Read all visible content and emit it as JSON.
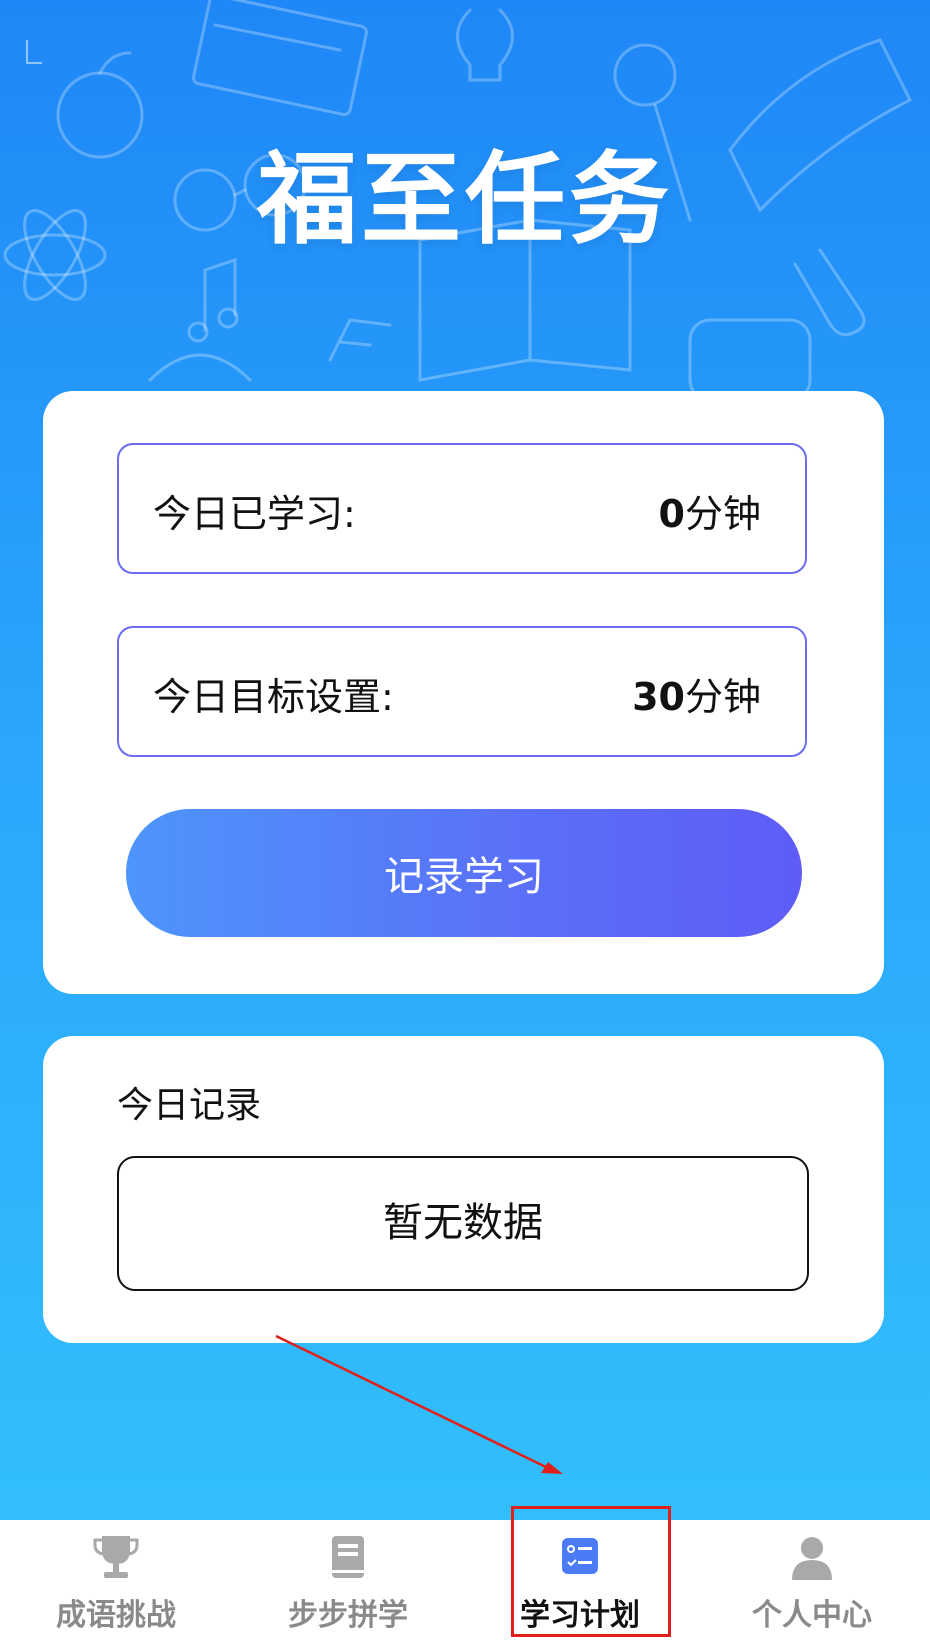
{
  "header": {
    "title": "福至任务"
  },
  "today_card": {
    "studied_label": "今日已学习:",
    "studied_value": "0",
    "studied_unit": "分钟",
    "goal_label": "今日目标设置:",
    "goal_value": "30",
    "goal_unit": "分钟",
    "record_button": "记录学习"
  },
  "record_card": {
    "title": "今日记录",
    "empty_text": "暂无数据"
  },
  "tabbar": {
    "tabs": [
      {
        "label": "成语挑战",
        "icon": "trophy-icon"
      },
      {
        "label": "步步拼学",
        "icon": "book-icon"
      },
      {
        "label": "学习计划",
        "icon": "plan-list-icon",
        "active": true
      },
      {
        "label": "个人中心",
        "icon": "person-icon"
      }
    ]
  },
  "colors": {
    "accent": "#5f5cf7",
    "active_tab_icon": "#4a7cf7",
    "inactive_tab": "#8a8a8a",
    "annotation": "#e0201b"
  }
}
